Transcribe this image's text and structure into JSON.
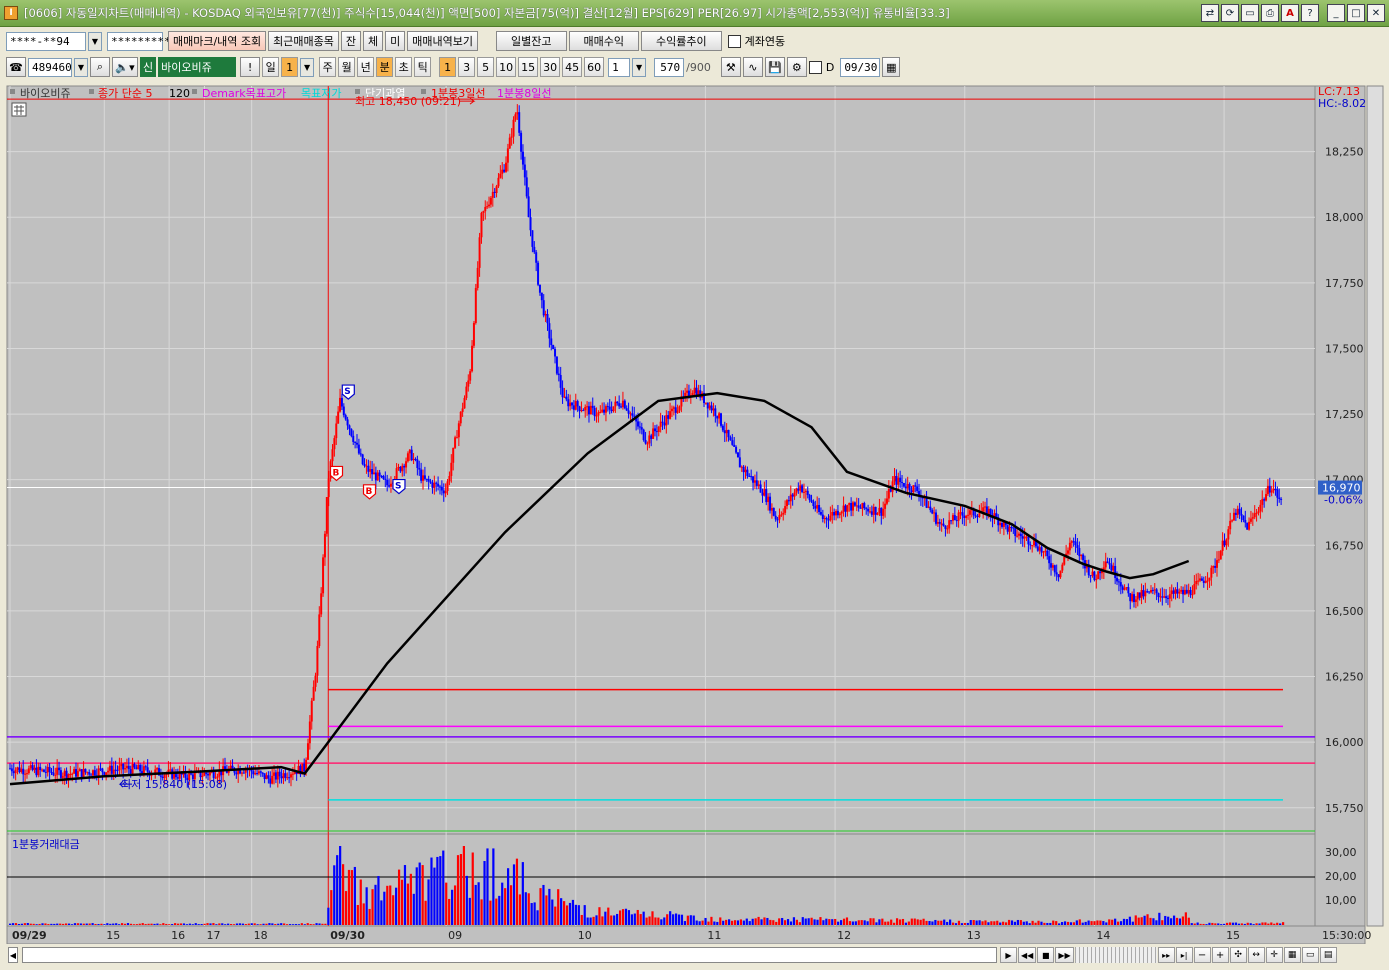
{
  "window": {
    "title": "[0606] 자동일지차트(매매내역) - KOSDAQ 외국인보유[77(천)] 주식수[15,044(천)] 액면[500] 자본금[75(억)] 결산[12월] EPS[629] PER[26.97] 시가총액[2,553(억)] 유통비율[33.3]",
    "app_icon": "I"
  },
  "toolbar1": {
    "account_value": "****-**94",
    "password_value": "*********",
    "btn_trade_mark": "매매마크/내역 조회",
    "btn_recent": "최근매매종목",
    "btn_jan": "잔",
    "btn_che": "체",
    "btn_mi": "미",
    "btn_trade_view": "매매내역보기",
    "btn_daily": "일별잔고",
    "btn_profit": "매매수익",
    "btn_return": "수익률추이",
    "chk_account_link": "계좌연동"
  },
  "toolbar2": {
    "code_value": "489460",
    "badge_sin": "신",
    "stock_name": "바이오비쥬",
    "btn_excl": "!",
    "period_day": "일",
    "period_count": "1",
    "periods": [
      "주",
      "월",
      "년",
      "분",
      "초",
      "틱"
    ],
    "intervals": [
      "1",
      "3",
      "5",
      "10",
      "15",
      "30",
      "45",
      "60"
    ],
    "interval_input": "1",
    "count_value": "570",
    "count_max": "/900",
    "chk_d": "D",
    "date_value": "09/30"
  },
  "legend": {
    "stock": "바이오비쥬",
    "ma": "종가 단순 5",
    "ma_period": "120",
    "demark_high": "Demark목표고가",
    "demark_low": "목표저가",
    "short_over": "단기과열",
    "line3": "1분봉3일선",
    "line8": "1분봉8일선"
  },
  "colors": {
    "up": "#ff0000",
    "down": "#0000ff",
    "ma": "#000000",
    "demark_high": "#ff00ff",
    "demark_low": "#00e5e5",
    "short_over": "#ffffff",
    "line3": "#ff0000",
    "line8": "#ff00ff",
    "plot_bg": "#c0c0c0"
  },
  "price_info": {
    "lc": "LC:7.13",
    "hc": "HC:-8.02",
    "current": "16,970",
    "change": "-0.06%",
    "high_label": "최고 18,450 (09:21)",
    "low_label": "최저 15,840 (15:08)"
  },
  "volume_panel": {
    "title": "1분봉거래대금",
    "levels": [
      "30,00",
      "20,00",
      "10,00"
    ]
  },
  "time_readout": "15:30:00",
  "chart_data": {
    "type": "candlestick",
    "y_ticks": [
      "18,250",
      "18,000",
      "17,750",
      "17,500",
      "17,250",
      "17,000",
      "16,750",
      "16,500",
      "16,250",
      "16,000",
      "15,750"
    ],
    "x_ticks": [
      "09/29",
      "15",
      "16",
      "17",
      "18",
      "09/30",
      "09",
      "10",
      "11",
      "12",
      "13",
      "14",
      "15"
    ],
    "ylim": [
      15650,
      18500
    ],
    "high": 18450,
    "low": 15840,
    "close": 16970,
    "levels": [
      {
        "name": "short-over",
        "value": 16020
      },
      {
        "name": "demark-high",
        "value": 16060
      },
      {
        "name": "line3",
        "value": 16200
      },
      {
        "name": "line8",
        "value": 15920
      },
      {
        "name": "demark-low",
        "value": 15780
      }
    ],
    "ma_path": [
      [
        15840,
        0
      ],
      [
        15870,
        0.08
      ],
      [
        15890,
        0.17
      ],
      [
        15905,
        0.23
      ],
      [
        15880,
        0.25
      ],
      [
        16000,
        0.27
      ],
      [
        16300,
        0.32
      ],
      [
        16500,
        0.36
      ],
      [
        16800,
        0.42
      ],
      [
        17100,
        0.49
      ],
      [
        17300,
        0.55
      ],
      [
        17330,
        0.6
      ],
      [
        17300,
        0.64
      ],
      [
        17200,
        0.68
      ],
      [
        17030,
        0.71
      ],
      [
        16950,
        0.76
      ],
      [
        16900,
        0.81
      ],
      [
        16830,
        0.85
      ],
      [
        16740,
        0.88
      ],
      [
        16680,
        0.91
      ],
      [
        16650,
        0.93
      ],
      [
        16625,
        0.95
      ],
      [
        16640,
        0.97
      ],
      [
        16690,
        1.0
      ]
    ],
    "price_path": [
      [
        15900,
        0
      ],
      [
        15880,
        0.05
      ],
      [
        15900,
        0.1
      ],
      [
        15870,
        0.15
      ],
      [
        15900,
        0.2
      ],
      [
        15860,
        0.22
      ],
      [
        15890,
        0.24
      ],
      [
        15900,
        0.25
      ],
      [
        16300,
        0.26
      ],
      [
        17000,
        0.27
      ],
      [
        17300,
        0.28
      ],
      [
        17050,
        0.3
      ],
      [
        16980,
        0.32
      ],
      [
        17100,
        0.34
      ],
      [
        17000,
        0.35
      ],
      [
        16960,
        0.37
      ],
      [
        17200,
        0.38
      ],
      [
        17400,
        0.39
      ],
      [
        18000,
        0.4
      ],
      [
        18200,
        0.42
      ],
      [
        18420,
        0.43
      ],
      [
        18000,
        0.44
      ],
      [
        17700,
        0.45
      ],
      [
        17500,
        0.46
      ],
      [
        17300,
        0.47
      ],
      [
        17250,
        0.5
      ],
      [
        17300,
        0.52
      ],
      [
        17150,
        0.54
      ],
      [
        17250,
        0.56
      ],
      [
        17350,
        0.58
      ],
      [
        17250,
        0.6
      ],
      [
        17050,
        0.62
      ],
      [
        16950,
        0.64
      ],
      [
        16850,
        0.65
      ],
      [
        16980,
        0.67
      ],
      [
        16850,
        0.69
      ],
      [
        16900,
        0.71
      ],
      [
        16880,
        0.74
      ],
      [
        17000,
        0.75
      ],
      [
        16960,
        0.77
      ],
      [
        16820,
        0.79
      ],
      [
        16870,
        0.81
      ],
      [
        16880,
        0.83
      ],
      [
        16800,
        0.85
      ],
      [
        16760,
        0.87
      ],
      [
        16640,
        0.89
      ],
      [
        16770,
        0.9
      ],
      [
        16620,
        0.92
      ],
      [
        16700,
        0.93
      ],
      [
        16550,
        0.95
      ],
      [
        16570,
        0.97
      ],
      [
        16560,
        0.98
      ],
      [
        16570,
        1.0
      ],
      [
        16650,
        1.02
      ],
      [
        16880,
        1.04
      ],
      [
        16820,
        1.05
      ],
      [
        16980,
        1.07
      ],
      [
        16900,
        1.08
      ]
    ],
    "volume_path": [
      [
        0.3,
        0.27
      ],
      [
        1.0,
        0.28
      ],
      [
        0.7,
        0.29
      ],
      [
        0.5,
        0.3
      ],
      [
        0.9,
        0.4
      ],
      [
        0.8,
        0.42
      ],
      [
        0.6,
        0.44
      ],
      [
        0.4,
        0.46
      ],
      [
        0.3,
        0.48
      ],
      [
        0.2,
        0.5
      ],
      [
        0.15,
        0.55
      ],
      [
        0.1,
        0.6
      ],
      [
        0.08,
        0.7
      ],
      [
        0.06,
        0.8
      ],
      [
        0.05,
        0.9
      ],
      [
        0.15,
        1.0
      ]
    ]
  }
}
